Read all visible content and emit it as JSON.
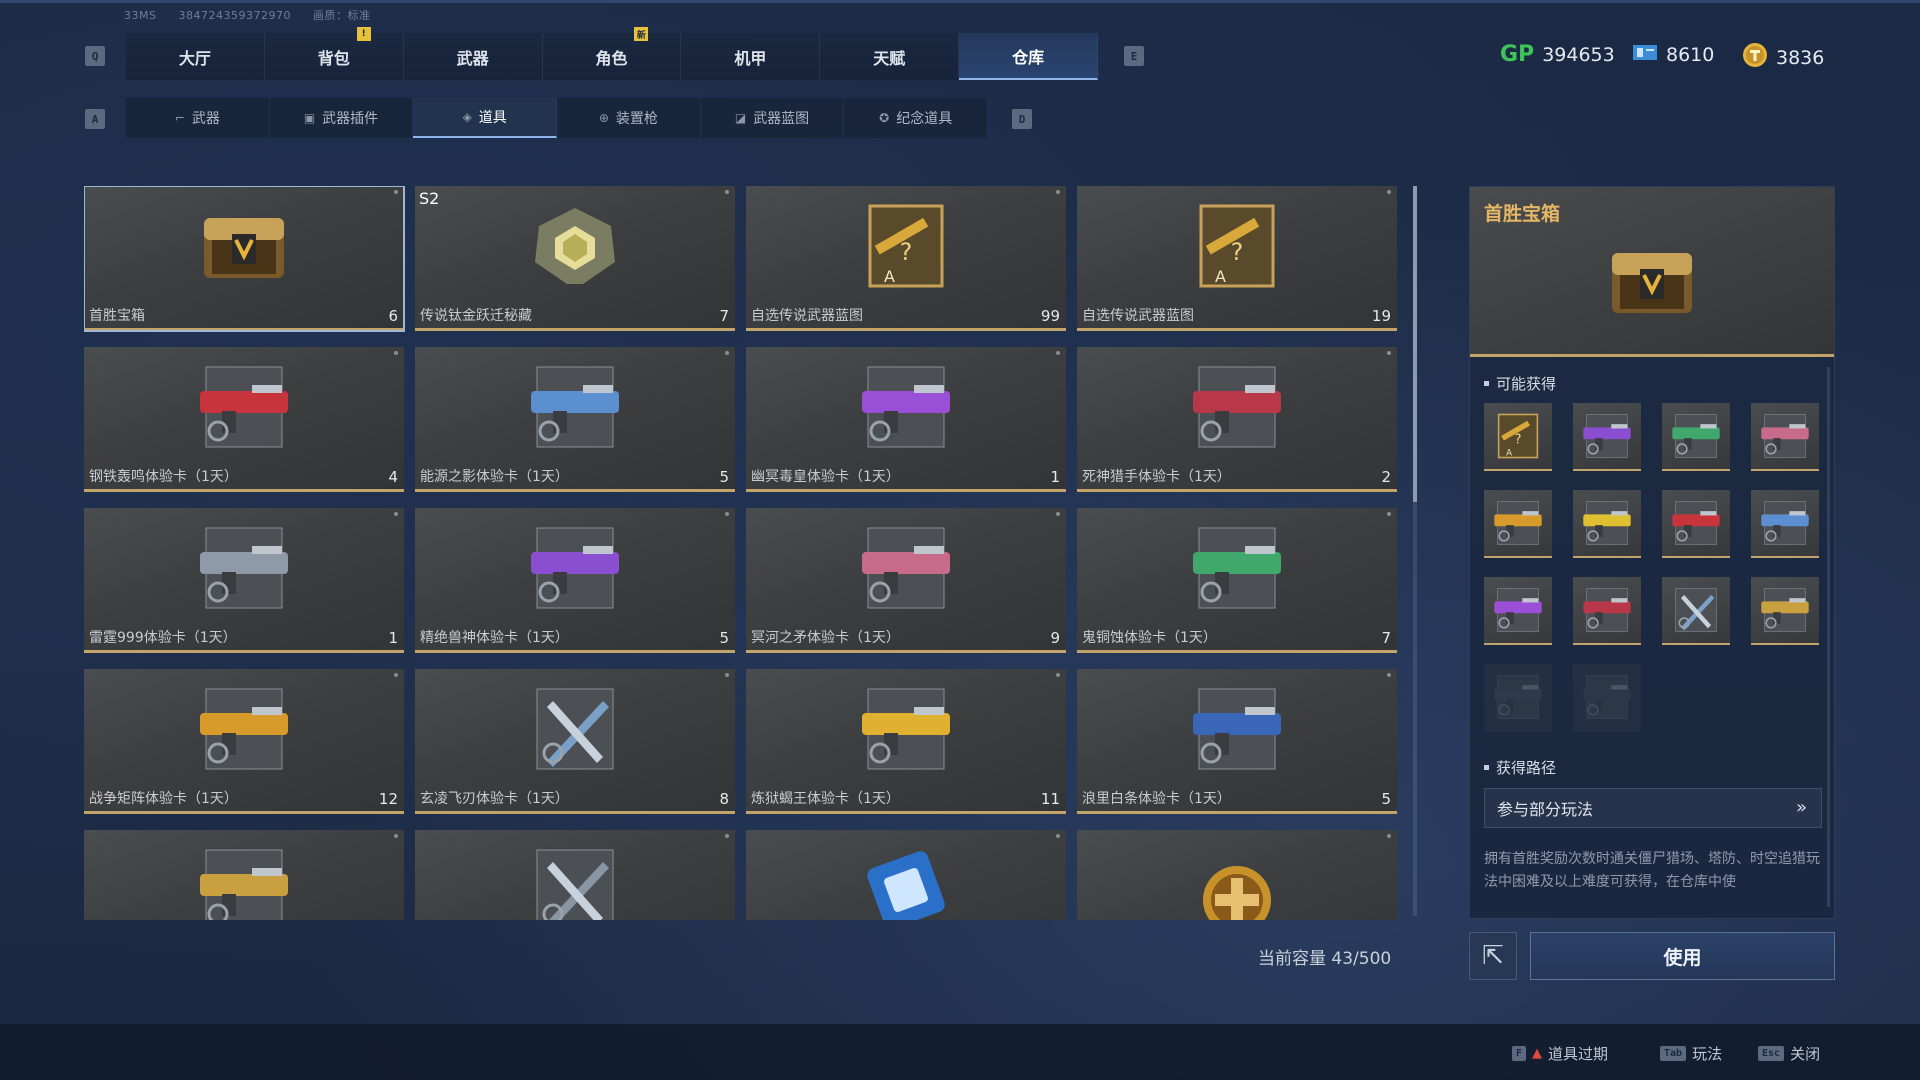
{
  "sysinfo": {
    "ping": "33MS",
    "id": "384724359372970",
    "quality": "画质：标准"
  },
  "keys": {
    "q": "Q",
    "e": "E",
    "a": "A",
    "d": "D"
  },
  "main_tabs": [
    {
      "label": "大厅"
    },
    {
      "label": "背包",
      "badge": "!"
    },
    {
      "label": "武器"
    },
    {
      "label": "角色",
      "badge": "新"
    },
    {
      "label": "机甲"
    },
    {
      "label": "天赋"
    },
    {
      "label": "仓库",
      "active": true
    }
  ],
  "currency": {
    "gp_icon": "GP",
    "gp": "394653",
    "ticket": "8610",
    "coin": "3836"
  },
  "sub_tabs": [
    {
      "label": "武器",
      "icon": "gun-icon"
    },
    {
      "label": "武器插件",
      "icon": "plugin-icon"
    },
    {
      "label": "道具",
      "icon": "item-icon",
      "active": true
    },
    {
      "label": "装置枪",
      "icon": "device-gun-icon"
    },
    {
      "label": "武器蓝图",
      "icon": "blueprint-icon"
    },
    {
      "label": "纪念道具",
      "icon": "memorial-icon"
    }
  ],
  "items": [
    {
      "name": "首胜宝箱",
      "qty": "6",
      "kind": "chest",
      "selected": true
    },
    {
      "name": "传说钛金跃迁秘藏",
      "qty": "7",
      "kind": "orb",
      "tag": "S2"
    },
    {
      "name": "自选传说武器蓝图",
      "qty": "99",
      "kind": "blueprint"
    },
    {
      "name": "自选传说武器蓝图",
      "qty": "19",
      "kind": "blueprint"
    },
    {
      "name": "钢铁轰鸣体验卡（1天）",
      "qty": "4",
      "kind": "gun",
      "color": "#c8343c"
    },
    {
      "name": "能源之影体验卡（1天）",
      "qty": "5",
      "kind": "gun",
      "color": "#5b8fd0"
    },
    {
      "name": "幽冥毒皇体验卡（1天）",
      "qty": "1",
      "kind": "gun",
      "color": "#9b4fd6"
    },
    {
      "name": "死神猎手体验卡（1天）",
      "qty": "2",
      "kind": "gun",
      "color": "#b8384a"
    },
    {
      "name": "雷霆999体验卡（1天）",
      "qty": "1",
      "kind": "gun",
      "color": "#8f9aa8"
    },
    {
      "name": "精绝兽神体验卡（1天）",
      "qty": "5",
      "kind": "gun",
      "color": "#8a4fd0"
    },
    {
      "name": "冥河之矛体验卡（1天）",
      "qty": "9",
      "kind": "gun",
      "color": "#c86a8a"
    },
    {
      "name": "鬼铜蚀体验卡（1天）",
      "qty": "7",
      "kind": "gun",
      "color": "#3fa86a"
    },
    {
      "name": "战争矩阵体验卡（1天）",
      "qty": "12",
      "kind": "gun",
      "color": "#d89a2a"
    },
    {
      "name": "玄凌飞刃体验卡（1天）",
      "qty": "8",
      "kind": "blade",
      "color": "#7aa0c8"
    },
    {
      "name": "炼狱蝎王体验卡（1天）",
      "qty": "11",
      "kind": "gun",
      "color": "#e0b030"
    },
    {
      "name": "浪里白条体验卡（1天）",
      "qty": "5",
      "kind": "gun",
      "color": "#3a66b8"
    },
    {
      "name": "",
      "qty": "",
      "kind": "gun",
      "color": "#c8a040"
    },
    {
      "name": "",
      "qty": "",
      "kind": "blade",
      "color": "#8a95a4"
    },
    {
      "name": "",
      "qty": "",
      "kind": "chip"
    },
    {
      "name": "",
      "qty": "",
      "kind": "coin"
    }
  ],
  "capacity": "当前容量 43/500",
  "detail": {
    "title": "首胜宝箱",
    "rewards_title": "可能获得",
    "rewards": [
      {
        "kind": "blueprint"
      },
      {
        "kind": "gun",
        "color": "#8a4fd0"
      },
      {
        "kind": "gun",
        "color": "#3fa86a"
      },
      {
        "kind": "gun",
        "color": "#c86a8a"
      },
      {
        "kind": "gun",
        "color": "#d89a2a"
      },
      {
        "kind": "gun",
        "color": "#e0c030"
      },
      {
        "kind": "gun",
        "color": "#c8343c"
      },
      {
        "kind": "gun",
        "color": "#5b8fd0"
      },
      {
        "kind": "gun",
        "color": "#9b4fd6"
      },
      {
        "kind": "gun",
        "color": "#b8384a"
      },
      {
        "kind": "blade",
        "color": "#7aa0c8"
      },
      {
        "kind": "gun",
        "color": "#c8a040"
      },
      {
        "kind": "gun",
        "color": "#555d6a",
        "dim": true
      },
      {
        "kind": "gun",
        "color": "#4a5260",
        "dim": true
      }
    ],
    "path_title": "获得路径",
    "path_button": "参与部分玩法",
    "description": "拥有首胜奖励次数时通关僵尸猎场、塔防、时空追猎玩法中困难及以上难度可获得，在仓库中使"
  },
  "use_button": "使用",
  "hints": [
    {
      "key": "F",
      "label": "道具过期",
      "warn": "▲"
    },
    {
      "key": "Tab",
      "label": "玩法"
    },
    {
      "key": "Esc",
      "label": "关闭"
    }
  ]
}
